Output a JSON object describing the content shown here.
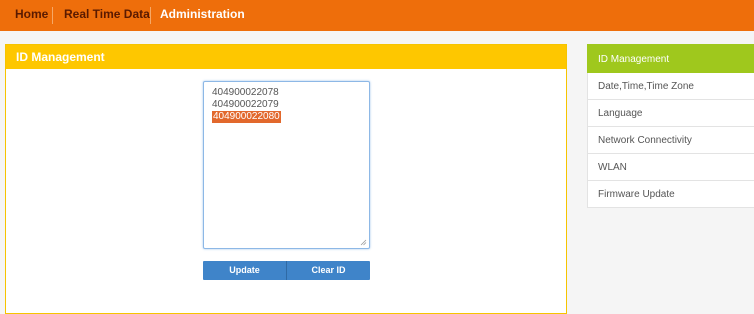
{
  "nav": {
    "items": [
      {
        "label": "Home",
        "active": false
      },
      {
        "label": "Real Time Data",
        "active": false
      },
      {
        "label": "Administration",
        "active": true
      }
    ]
  },
  "panel": {
    "title": "ID Management",
    "ids": [
      "404900022078",
      "404900022079",
      "404900022080"
    ],
    "selected_index": 2,
    "buttons": {
      "update": "Update",
      "clear": "Clear ID"
    }
  },
  "sidebar": {
    "items": [
      {
        "label": "ID Management",
        "active": true
      },
      {
        "label": "Date,Time,Time Zone",
        "active": false
      },
      {
        "label": "Language",
        "active": false
      },
      {
        "label": "Network Connectivity",
        "active": false
      },
      {
        "label": "WLAN",
        "active": false
      },
      {
        "label": "Firmware Update",
        "active": false
      }
    ]
  },
  "colors": {
    "topbar": "#ee6e0b",
    "panel_header": "#fec700",
    "sidebar_active": "#9fc81d",
    "button": "#3f84c9",
    "selection": "#e2682c"
  }
}
